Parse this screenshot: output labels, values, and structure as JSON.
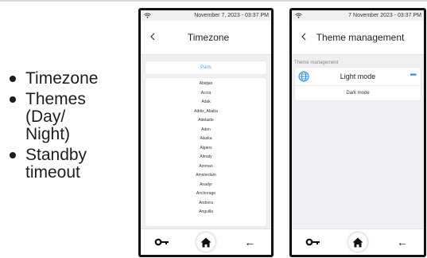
{
  "bullets": [
    {
      "text": "Timezone"
    },
    {
      "text": "Themes\n(Day/\nNight)"
    },
    {
      "text": "Standby\ntimeout"
    }
  ],
  "phone1": {
    "status_time": "November 7, 2023 - 03:37 PM",
    "back_icon": "chevron-left-icon",
    "title": "Timezone",
    "selected": "Paris",
    "accent": "#42a5f5",
    "timezones": [
      "Abidjan",
      "Accra",
      "Adak",
      "Addis_Ababa",
      "Adelaide",
      "Aden",
      "Alaska",
      "Algiers",
      "Almaty",
      "Amman",
      "Amsterdam",
      "Anadyr",
      "Anchorage",
      "Andorra",
      "Anguilla"
    ]
  },
  "phone2": {
    "status_time": "7 November 2023 - 03:37 PM",
    "back_icon": "chevron-left-icon",
    "title": "Theme management",
    "section_label": "Theme management",
    "light_mode": "Light mode",
    "dark_mode": "Dark mode",
    "more": "•••",
    "accent": "#3a8de0"
  },
  "navbar": {
    "left_icon": "key-icon",
    "center_icon": "home-icon",
    "right_icon": "arrow-left-icon",
    "back_glyph": "←"
  }
}
